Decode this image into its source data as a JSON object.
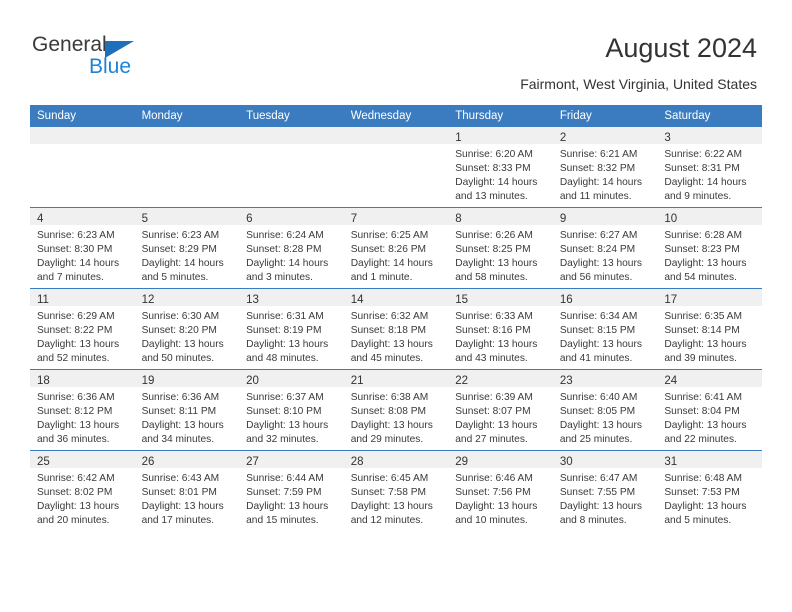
{
  "brand": {
    "name_part1": "General",
    "name_part2": "Blue",
    "icon": "triangle-logo-icon",
    "color_dark": "#3b3b3b",
    "color_blue": "#1e83d6"
  },
  "header": {
    "title": "August 2024",
    "subtitle": "Fairmont, West Virginia, United States"
  },
  "theme": {
    "header_bg": "#3a7cbf",
    "header_text": "#ffffff",
    "daynum_band": "#f0f0f0",
    "row_divider": "#3a7cbf"
  },
  "weekday_headers": [
    "Sunday",
    "Monday",
    "Tuesday",
    "Wednesday",
    "Thursday",
    "Friday",
    "Saturday"
  ],
  "weeks": [
    [
      {
        "day": "",
        "sunrise": "",
        "sunset": "",
        "daylight_line1": "",
        "daylight_line2": "",
        "empty": true
      },
      {
        "day": "",
        "sunrise": "",
        "sunset": "",
        "daylight_line1": "",
        "daylight_line2": "",
        "empty": true
      },
      {
        "day": "",
        "sunrise": "",
        "sunset": "",
        "daylight_line1": "",
        "daylight_line2": "",
        "empty": true
      },
      {
        "day": "",
        "sunrise": "",
        "sunset": "",
        "daylight_line1": "",
        "daylight_line2": "",
        "empty": true
      },
      {
        "day": "1",
        "sunrise": "Sunrise: 6:20 AM",
        "sunset": "Sunset: 8:33 PM",
        "daylight_line1": "Daylight: 14 hours",
        "daylight_line2": "and 13 minutes.",
        "empty": false
      },
      {
        "day": "2",
        "sunrise": "Sunrise: 6:21 AM",
        "sunset": "Sunset: 8:32 PM",
        "daylight_line1": "Daylight: 14 hours",
        "daylight_line2": "and 11 minutes.",
        "empty": false
      },
      {
        "day": "3",
        "sunrise": "Sunrise: 6:22 AM",
        "sunset": "Sunset: 8:31 PM",
        "daylight_line1": "Daylight: 14 hours",
        "daylight_line2": "and 9 minutes.",
        "empty": false
      }
    ],
    [
      {
        "day": "4",
        "sunrise": "Sunrise: 6:23 AM",
        "sunset": "Sunset: 8:30 PM",
        "daylight_line1": "Daylight: 14 hours",
        "daylight_line2": "and 7 minutes.",
        "empty": false
      },
      {
        "day": "5",
        "sunrise": "Sunrise: 6:23 AM",
        "sunset": "Sunset: 8:29 PM",
        "daylight_line1": "Daylight: 14 hours",
        "daylight_line2": "and 5 minutes.",
        "empty": false
      },
      {
        "day": "6",
        "sunrise": "Sunrise: 6:24 AM",
        "sunset": "Sunset: 8:28 PM",
        "daylight_line1": "Daylight: 14 hours",
        "daylight_line2": "and 3 minutes.",
        "empty": false
      },
      {
        "day": "7",
        "sunrise": "Sunrise: 6:25 AM",
        "sunset": "Sunset: 8:26 PM",
        "daylight_line1": "Daylight: 14 hours",
        "daylight_line2": "and 1 minute.",
        "empty": false
      },
      {
        "day": "8",
        "sunrise": "Sunrise: 6:26 AM",
        "sunset": "Sunset: 8:25 PM",
        "daylight_line1": "Daylight: 13 hours",
        "daylight_line2": "and 58 minutes.",
        "empty": false
      },
      {
        "day": "9",
        "sunrise": "Sunrise: 6:27 AM",
        "sunset": "Sunset: 8:24 PM",
        "daylight_line1": "Daylight: 13 hours",
        "daylight_line2": "and 56 minutes.",
        "empty": false
      },
      {
        "day": "10",
        "sunrise": "Sunrise: 6:28 AM",
        "sunset": "Sunset: 8:23 PM",
        "daylight_line1": "Daylight: 13 hours",
        "daylight_line2": "and 54 minutes.",
        "empty": false
      }
    ],
    [
      {
        "day": "11",
        "sunrise": "Sunrise: 6:29 AM",
        "sunset": "Sunset: 8:22 PM",
        "daylight_line1": "Daylight: 13 hours",
        "daylight_line2": "and 52 minutes.",
        "empty": false
      },
      {
        "day": "12",
        "sunrise": "Sunrise: 6:30 AM",
        "sunset": "Sunset: 8:20 PM",
        "daylight_line1": "Daylight: 13 hours",
        "daylight_line2": "and 50 minutes.",
        "empty": false
      },
      {
        "day": "13",
        "sunrise": "Sunrise: 6:31 AM",
        "sunset": "Sunset: 8:19 PM",
        "daylight_line1": "Daylight: 13 hours",
        "daylight_line2": "and 48 minutes.",
        "empty": false
      },
      {
        "day": "14",
        "sunrise": "Sunrise: 6:32 AM",
        "sunset": "Sunset: 8:18 PM",
        "daylight_line1": "Daylight: 13 hours",
        "daylight_line2": "and 45 minutes.",
        "empty": false
      },
      {
        "day": "15",
        "sunrise": "Sunrise: 6:33 AM",
        "sunset": "Sunset: 8:16 PM",
        "daylight_line1": "Daylight: 13 hours",
        "daylight_line2": "and 43 minutes.",
        "empty": false
      },
      {
        "day": "16",
        "sunrise": "Sunrise: 6:34 AM",
        "sunset": "Sunset: 8:15 PM",
        "daylight_line1": "Daylight: 13 hours",
        "daylight_line2": "and 41 minutes.",
        "empty": false
      },
      {
        "day": "17",
        "sunrise": "Sunrise: 6:35 AM",
        "sunset": "Sunset: 8:14 PM",
        "daylight_line1": "Daylight: 13 hours",
        "daylight_line2": "and 39 minutes.",
        "empty": false
      }
    ],
    [
      {
        "day": "18",
        "sunrise": "Sunrise: 6:36 AM",
        "sunset": "Sunset: 8:12 PM",
        "daylight_line1": "Daylight: 13 hours",
        "daylight_line2": "and 36 minutes.",
        "empty": false
      },
      {
        "day": "19",
        "sunrise": "Sunrise: 6:36 AM",
        "sunset": "Sunset: 8:11 PM",
        "daylight_line1": "Daylight: 13 hours",
        "daylight_line2": "and 34 minutes.",
        "empty": false
      },
      {
        "day": "20",
        "sunrise": "Sunrise: 6:37 AM",
        "sunset": "Sunset: 8:10 PM",
        "daylight_line1": "Daylight: 13 hours",
        "daylight_line2": "and 32 minutes.",
        "empty": false
      },
      {
        "day": "21",
        "sunrise": "Sunrise: 6:38 AM",
        "sunset": "Sunset: 8:08 PM",
        "daylight_line1": "Daylight: 13 hours",
        "daylight_line2": "and 29 minutes.",
        "empty": false
      },
      {
        "day": "22",
        "sunrise": "Sunrise: 6:39 AM",
        "sunset": "Sunset: 8:07 PM",
        "daylight_line1": "Daylight: 13 hours",
        "daylight_line2": "and 27 minutes.",
        "empty": false
      },
      {
        "day": "23",
        "sunrise": "Sunrise: 6:40 AM",
        "sunset": "Sunset: 8:05 PM",
        "daylight_line1": "Daylight: 13 hours",
        "daylight_line2": "and 25 minutes.",
        "empty": false
      },
      {
        "day": "24",
        "sunrise": "Sunrise: 6:41 AM",
        "sunset": "Sunset: 8:04 PM",
        "daylight_line1": "Daylight: 13 hours",
        "daylight_line2": "and 22 minutes.",
        "empty": false
      }
    ],
    [
      {
        "day": "25",
        "sunrise": "Sunrise: 6:42 AM",
        "sunset": "Sunset: 8:02 PM",
        "daylight_line1": "Daylight: 13 hours",
        "daylight_line2": "and 20 minutes.",
        "empty": false
      },
      {
        "day": "26",
        "sunrise": "Sunrise: 6:43 AM",
        "sunset": "Sunset: 8:01 PM",
        "daylight_line1": "Daylight: 13 hours",
        "daylight_line2": "and 17 minutes.",
        "empty": false
      },
      {
        "day": "27",
        "sunrise": "Sunrise: 6:44 AM",
        "sunset": "Sunset: 7:59 PM",
        "daylight_line1": "Daylight: 13 hours",
        "daylight_line2": "and 15 minutes.",
        "empty": false
      },
      {
        "day": "28",
        "sunrise": "Sunrise: 6:45 AM",
        "sunset": "Sunset: 7:58 PM",
        "daylight_line1": "Daylight: 13 hours",
        "daylight_line2": "and 12 minutes.",
        "empty": false
      },
      {
        "day": "29",
        "sunrise": "Sunrise: 6:46 AM",
        "sunset": "Sunset: 7:56 PM",
        "daylight_line1": "Daylight: 13 hours",
        "daylight_line2": "and 10 minutes.",
        "empty": false
      },
      {
        "day": "30",
        "sunrise": "Sunrise: 6:47 AM",
        "sunset": "Sunset: 7:55 PM",
        "daylight_line1": "Daylight: 13 hours",
        "daylight_line2": "and 8 minutes.",
        "empty": false
      },
      {
        "day": "31",
        "sunrise": "Sunrise: 6:48 AM",
        "sunset": "Sunset: 7:53 PM",
        "daylight_line1": "Daylight: 13 hours",
        "daylight_line2": "and 5 minutes.",
        "empty": false
      }
    ]
  ]
}
